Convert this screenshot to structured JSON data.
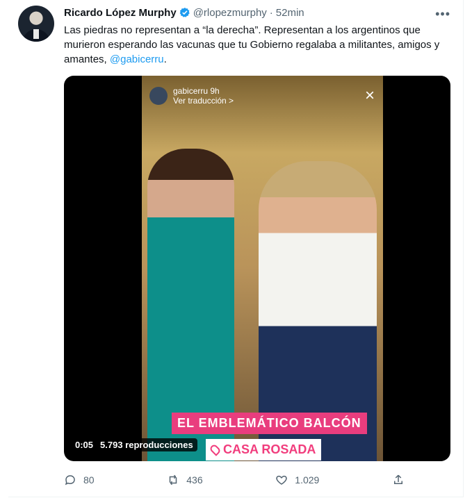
{
  "tweet": {
    "author_name": "Ricardo López Murphy",
    "handle": "@rlopezmurphy",
    "separator": "·",
    "time": "52min",
    "text_part1": "Las piedras no representan a “la derecha”. Representan a los argentinos que murieron esperando las vacunas que tu Gobierno regalaba a militantes, amigos y amantes, ",
    "mention": "@gabicerru",
    "text_part2": ".",
    "more_icon": "more-horizontal-icon"
  },
  "media": {
    "story_user": "gabicerru",
    "story_time": "9h",
    "translation_link": "Ver traducción >",
    "banner": "EL EMBLEMÁTICO BALCÓN",
    "location": "CASA ROSADA",
    "duration": "0:05",
    "views": "5.793 reproducciones",
    "close_icon": "close-icon"
  },
  "actions": {
    "replies": "80",
    "retweets": "436",
    "likes": "1.029"
  },
  "colors": {
    "accent": "#1d9bf0",
    "secondary_text": "#536471",
    "banner": "#e93d7e"
  }
}
